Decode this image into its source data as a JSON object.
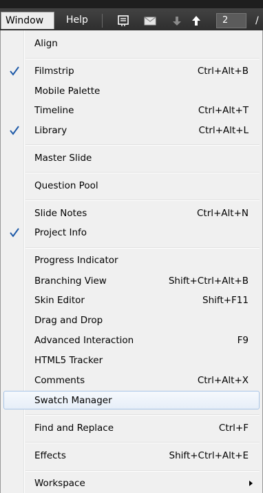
{
  "menubar": {
    "window_label": "Window",
    "help_label": "Help",
    "page_value": "2",
    "page_separator": "/"
  },
  "menu": {
    "items": [
      {
        "label": "Align",
        "shortcut": "",
        "checked": false
      },
      {
        "label": "Filmstrip",
        "shortcut": "Ctrl+Alt+B",
        "checked": true
      },
      {
        "label": "Mobile Palette",
        "shortcut": "",
        "checked": false
      },
      {
        "label": "Timeline",
        "shortcut": "Ctrl+Alt+T",
        "checked": false
      },
      {
        "label": "Library",
        "shortcut": "Ctrl+Alt+L",
        "checked": true
      },
      {
        "label": "Master Slide",
        "shortcut": "",
        "checked": false
      },
      {
        "label": "Question Pool",
        "shortcut": "",
        "checked": false
      },
      {
        "label": "Slide Notes",
        "shortcut": "Ctrl+Alt+N",
        "checked": false
      },
      {
        "label": "Project Info",
        "shortcut": "",
        "checked": true
      },
      {
        "label": "Progress Indicator",
        "shortcut": "",
        "checked": false
      },
      {
        "label": "Branching View",
        "shortcut": "Shift+Ctrl+Alt+B",
        "checked": false
      },
      {
        "label": "Skin Editor",
        "shortcut": "Shift+F11",
        "checked": false
      },
      {
        "label": "Drag and Drop",
        "shortcut": "",
        "checked": false
      },
      {
        "label": "Advanced Interaction",
        "shortcut": "F9",
        "checked": false
      },
      {
        "label": "HTML5 Tracker",
        "shortcut": "",
        "checked": false
      },
      {
        "label": "Comments",
        "shortcut": "Ctrl+Alt+X",
        "checked": false
      },
      {
        "label": "Swatch Manager",
        "shortcut": "",
        "checked": false,
        "highlighted": true
      },
      {
        "label": "Find and Replace",
        "shortcut": "Ctrl+F",
        "checked": false
      },
      {
        "label": "Effects",
        "shortcut": "Shift+Ctrl+Alt+E",
        "checked": false
      },
      {
        "label": "Workspace",
        "shortcut": "",
        "checked": false,
        "submenu": true
      }
    ]
  },
  "colors": {
    "menubar_bg": "#3a3a3a",
    "menu_bg": "#f0f0f0",
    "check_color": "#1e5aa8",
    "highlight_border": "#a8c4e6"
  },
  "icons": {
    "check": "checkmark-icon",
    "submenu": "submenu-arrow-icon",
    "notes": "slide-notes-icon",
    "mail": "mail-icon",
    "down": "arrow-down-icon",
    "up": "arrow-up-icon"
  }
}
